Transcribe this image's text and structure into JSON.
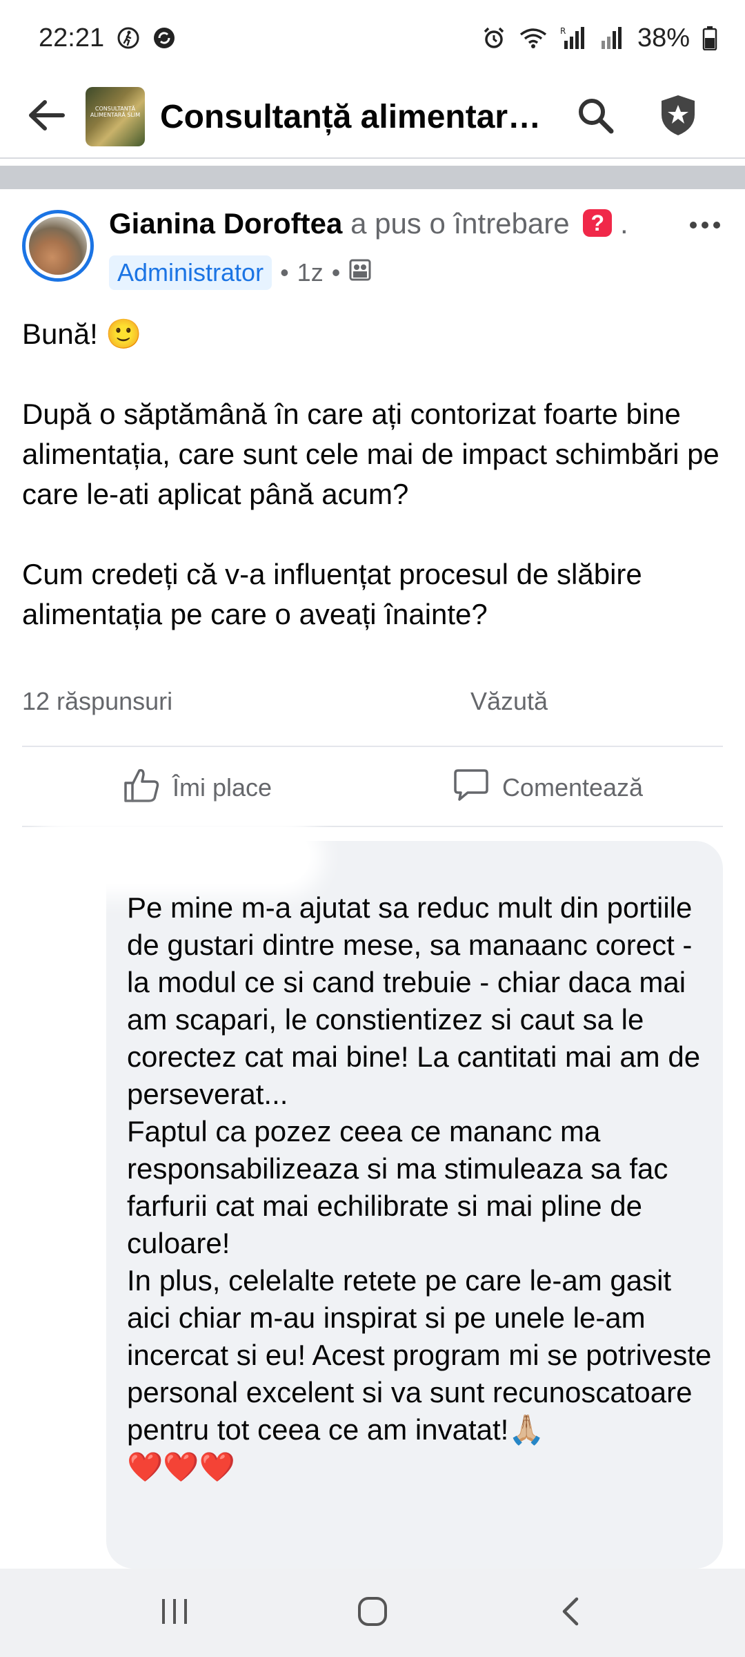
{
  "status_bar": {
    "time": "22:21",
    "battery": "38%"
  },
  "header": {
    "title": "Consultanță alimentară...",
    "thumb_text": "CONSULTANȚĂ ALIMENTARĂ SLIM"
  },
  "post": {
    "author": "Gianina Doroftea",
    "action": "a pus o întrebare",
    "question_badge": "?",
    "trailing_dot": ".",
    "role_badge": "Administrator",
    "time": "1z",
    "paragraphs": [
      "Bună! 🙂",
      "După o săptămână în care ați contorizat foarte bine alimentația, care sunt cele mai de impact schimbări pe care le-ati aplicat până acum?",
      "Cum credeți că v-a influențat procesul de slăbire alimentația pe care o aveați înainte?"
    ],
    "replies_count": "12 răspunsuri",
    "seen_by": "Văzută"
  },
  "actions": {
    "like_label": "Îmi place",
    "comment_label": "Comentează"
  },
  "comment": {
    "lines": [
      "Pe mine m-a ajutat sa reduc mult din portiile de gustari dintre mese, sa manaanc corect -la modul ce si cand trebuie - chiar daca mai am scapari, le constientizez si caut sa le corectez cat mai bine! La cantitati mai am de perseverat...",
      "Faptul ca pozez ceea ce mananc ma responsabilizeaza si ma stimuleaza sa fac farfurii cat mai echilibrate si mai pline de culoare!",
      "In plus, celelalte retete pe care le-am gasit aici chiar m-au inspirat si pe unele le-am incercat si eu! Acest program mi se potriveste personal excelent si va sunt recunoscatoare pentru tot ceea ce am invatat!🙏🏼",
      "❤️❤️❤️"
    ]
  },
  "colors": {
    "accent": "#1b74e4",
    "question": "#f02849",
    "secondary_text": "#65676b",
    "bubble": "#f0f2f5"
  },
  "icons": [
    "back-arrow-icon",
    "search-icon",
    "shield-star-icon",
    "thumbs-up-icon",
    "comment-icon",
    "recent-apps-icon",
    "home-icon",
    "nav-back-icon"
  ]
}
